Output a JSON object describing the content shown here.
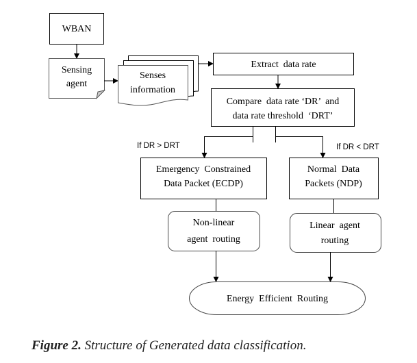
{
  "diagram": {
    "nodes": {
      "wban": {
        "label": "WBAN"
      },
      "sensing_agent": {
        "line1": "Sensing",
        "line2": "agent"
      },
      "senses_information": {
        "line1": "Senses",
        "line2": "information"
      },
      "extract": {
        "label": "Extract  data rate"
      },
      "compare": {
        "line1": "Compare  data rate ‘DR’  and",
        "line2": "data rate threshold  ‘DRT’"
      },
      "ecdp": {
        "line1": "Emergency  Constrained",
        "line2": "Data Packet (ECDP)"
      },
      "ndp": {
        "line1": "Normal  Data",
        "line2": "Packets (NDP)"
      },
      "nonlinear": {
        "line1": "Non-linear",
        "line2": "agent  routing"
      },
      "linear": {
        "line1": "Linear  agent",
        "line2": "routing"
      },
      "energy": {
        "label": "Energy  Efficient  Routing"
      }
    },
    "conditions": {
      "left": "If DR > DRT",
      "right": "If DR < DRT"
    },
    "edges": [
      [
        "wban",
        "sensing_agent"
      ],
      [
        "sensing_agent",
        "senses_information"
      ],
      [
        "senses_information",
        "extract"
      ],
      [
        "extract",
        "compare"
      ],
      [
        "compare",
        "ecdp"
      ],
      [
        "compare",
        "ndp"
      ],
      [
        "ecdp",
        "nonlinear"
      ],
      [
        "ndp",
        "linear"
      ],
      [
        "nonlinear",
        "energy"
      ],
      [
        "linear",
        "energy"
      ]
    ]
  },
  "caption": {
    "label": "Figure 2.",
    "text": " Structure of Generated data classification."
  }
}
